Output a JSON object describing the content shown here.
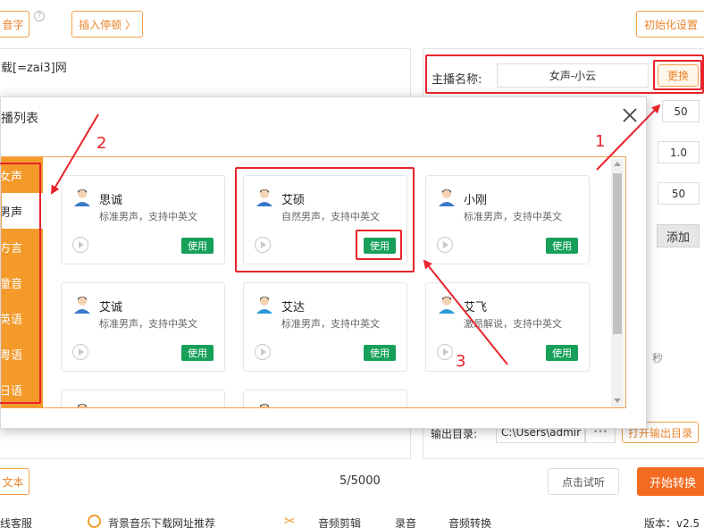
{
  "toolbar": {
    "pinyin_button": "音字",
    "help_icon": "?",
    "insert_pause_button": "插入停顿 〉",
    "init_settings_button": "初始化设置"
  },
  "editor": {
    "text": "载[=zai3]网"
  },
  "settings": {
    "anchor_label": "主播名称:",
    "anchor_value": "女声-小云",
    "change_button": "更换",
    "volume_value": "50",
    "speed_value": "1.0",
    "pitch_value": "50",
    "add_button": "添加",
    "seconds_unit": "秒",
    "output_label": "输出目录:",
    "output_path": "C:\\Users\\admir",
    "more_button": "•••",
    "open_output_button": "打开输出目录"
  },
  "dialog": {
    "title": "播列表",
    "categories": [
      {
        "label": "女声"
      },
      {
        "label": "男声"
      },
      {
        "label": "方言"
      },
      {
        "label": "童音"
      },
      {
        "label": "英语"
      },
      {
        "label": "粤语"
      },
      {
        "label": "日语"
      }
    ],
    "voices": [
      {
        "name": "思诚",
        "desc": "标准男声，支持中英文",
        "use": "使用"
      },
      {
        "name": "艾硕",
        "desc": "自然男声，支持中英文",
        "use": "使用"
      },
      {
        "name": "小刚",
        "desc": "标准男声，支持中英文",
        "use": "使用"
      },
      {
        "name": "艾诚",
        "desc": "标准男声，支持中英文",
        "use": "使用"
      },
      {
        "name": "艾达",
        "desc": "标准男声，支持中英文",
        "use": "使用"
      },
      {
        "name": "艾飞",
        "desc": "激昂解说，支持中英文",
        "use": "使用"
      }
    ]
  },
  "annotations": {
    "n1": "1",
    "n2": "2",
    "n3": "3"
  },
  "bottom": {
    "text_button": "文本",
    "char_count": "5/5000",
    "preview_button": "点击试听",
    "start_button": "开始转换"
  },
  "footer": {
    "service": "在线客服",
    "music_link": "背景音乐下载网址推荐",
    "audio_edit": "音频剪辑",
    "record": "录音",
    "audio_convert": "音频转换",
    "version": "版本：v2.5"
  },
  "colors": {
    "accent_orange": "#f39a2a",
    "use_green": "#17a05a",
    "annotation_red": "#e8232a",
    "start_button": "#f26b21"
  }
}
